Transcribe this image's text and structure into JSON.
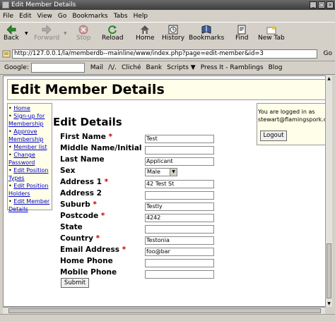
{
  "window": {
    "title": "Edit Member Details"
  },
  "menu": [
    "File",
    "Edit",
    "View",
    "Go",
    "Bookmarks",
    "Tabs",
    "Help"
  ],
  "nav": {
    "back": "Back",
    "forward": "Forward",
    "stop": "Stop",
    "reload": "Reload",
    "home": "Home",
    "history": "History",
    "bookmarks": "Bookmarks",
    "find": "Find",
    "new_tab": "New Tab"
  },
  "url": {
    "value": "http://127.0.0.1/la/memberdb--mainline/www/index.php?page=edit-member&id=3",
    "go": "Go"
  },
  "bookmarks_bar": {
    "google_label": "Google:",
    "items": [
      "Mail",
      "/\\/.",
      "Cliché",
      "Bank",
      "Scripts ▼",
      "Press It - Ramblings",
      "Blog"
    ]
  },
  "page": {
    "header": "Edit Member Details",
    "sidebar": [
      "Home",
      "Sign-up for Membership",
      "Approve Membership",
      "Member list",
      "Change Password",
      "Edit Position Types",
      "Edit Position Holders",
      "Edit Member Details"
    ],
    "login": {
      "text": "You are logged in as stewart@flamingspork.c",
      "button": "Logout"
    },
    "form_title": "Edit Details",
    "fields": [
      {
        "label": "First Name",
        "required": "*",
        "value": "Test"
      },
      {
        "label": "Middle Name/Initial",
        "required": "",
        "value": ""
      },
      {
        "label": "Last Name",
        "required": "",
        "value": "Applicant"
      },
      {
        "label": "Sex",
        "required": "",
        "value": "Male"
      },
      {
        "label": "Address 1",
        "required": "*",
        "value": "42 Test St"
      },
      {
        "label": "Address 2",
        "required": "",
        "value": ""
      },
      {
        "label": "Suburb",
        "required": "*",
        "value": "Testly"
      },
      {
        "label": "Postcode",
        "required": "*",
        "value": "4242"
      },
      {
        "label": "State",
        "required": "",
        "value": ""
      },
      {
        "label": "Country",
        "required": "*",
        "value": "Testonia"
      },
      {
        "label": "Email Address",
        "required": "*",
        "value": "foo@bar"
      },
      {
        "label": "Home Phone",
        "required": "",
        "value": ""
      },
      {
        "label": "Mobile Phone",
        "required": "",
        "value": ""
      }
    ],
    "submit": "Submit"
  },
  "colors": {
    "panel_bg": "#fffee8",
    "link": "#0000cc",
    "required": "#cc0000"
  },
  "icons": {
    "back": "left-arrow-green",
    "forward": "right-arrow-gray",
    "stop": "stop-red",
    "reload": "reload-green",
    "home": "house",
    "history": "history-book",
    "bookmarks": "bookmarks-book",
    "find": "find-page",
    "new_tab": "new-tab-star"
  }
}
